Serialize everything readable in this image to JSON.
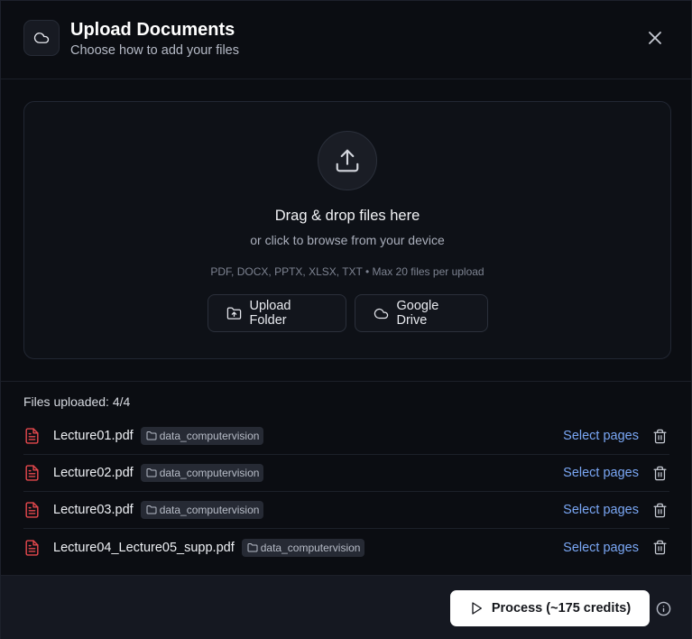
{
  "header": {
    "title": "Upload Documents",
    "subtitle": "Choose how to add your files",
    "icon": "cloud-icon",
    "close_icon": "close-icon"
  },
  "dropzone": {
    "icon": "upload-icon",
    "title": "Drag & drop files here",
    "subtitle": "or click to browse from your device",
    "formats": "PDF, DOCX, PPTX, XLSX, TXT • Max 20 files per upload",
    "buttons": {
      "upload_folder": "Upload Folder",
      "google_drive": "Google Drive"
    }
  },
  "files": {
    "count_label": "Files uploaded: 4/4",
    "select_label": "Select pages",
    "items": [
      {
        "name": "Lecture01.pdf",
        "folder": "data_computervision"
      },
      {
        "name": "Lecture02.pdf",
        "folder": "data_computervision"
      },
      {
        "name": "Lecture03.pdf",
        "folder": "data_computervision"
      },
      {
        "name": "Lecture04_Lecture05_supp.pdf",
        "folder": "data_computervision"
      }
    ]
  },
  "footer": {
    "process_label": "Process (~175 credits)",
    "info_icon": "info-icon"
  },
  "colors": {
    "background": "#0b0d12",
    "accent_link": "#7aa7f5",
    "file_icon": "#e5484d",
    "primary_button": "#ffffff"
  }
}
